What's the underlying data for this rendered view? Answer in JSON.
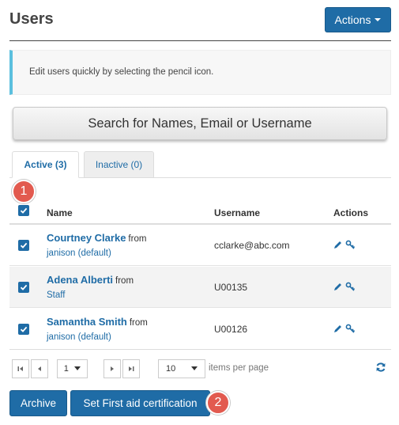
{
  "header": {
    "title": "Users",
    "actions_label": "Actions"
  },
  "info": {
    "text": "Edit users quickly by selecting the pencil icon."
  },
  "search": {
    "label": "Search for Names, Email or Username"
  },
  "tabs": [
    {
      "label": "Active (3)",
      "active": true
    },
    {
      "label": "Inactive (0)",
      "active": false
    }
  ],
  "table": {
    "headers": {
      "name": "Name",
      "username": "Username",
      "actions": "Actions"
    },
    "select_all_checked": true,
    "rows": [
      {
        "name": "Courtney Clarke",
        "from": "from",
        "org": "janison (default)",
        "username": "cclarke@abc.com",
        "checked": true
      },
      {
        "name": "Adena Alberti",
        "from": "from",
        "org": "Staff",
        "username": "U00135",
        "checked": true
      },
      {
        "name": "Samantha Smith",
        "from": "from",
        "org": "janison (default)",
        "username": "U00126",
        "checked": true
      }
    ]
  },
  "pager": {
    "page": "1",
    "page_size": "10",
    "items_per_page_label": "items per page"
  },
  "buttons": {
    "archive": "Archive",
    "set_first_aid": "Set First aid certification"
  },
  "badges": {
    "one": "1",
    "two": "2"
  },
  "icons": [
    "first-page-icon",
    "prev-page-icon",
    "next-page-icon",
    "last-page-icon",
    "refresh-icon",
    "pencil-icon",
    "key-icon",
    "checkbox-checked-icon"
  ],
  "colors": {
    "primary": "#1f6ca6",
    "info_accent": "#5bc0de",
    "badge": "#e25a4f"
  }
}
